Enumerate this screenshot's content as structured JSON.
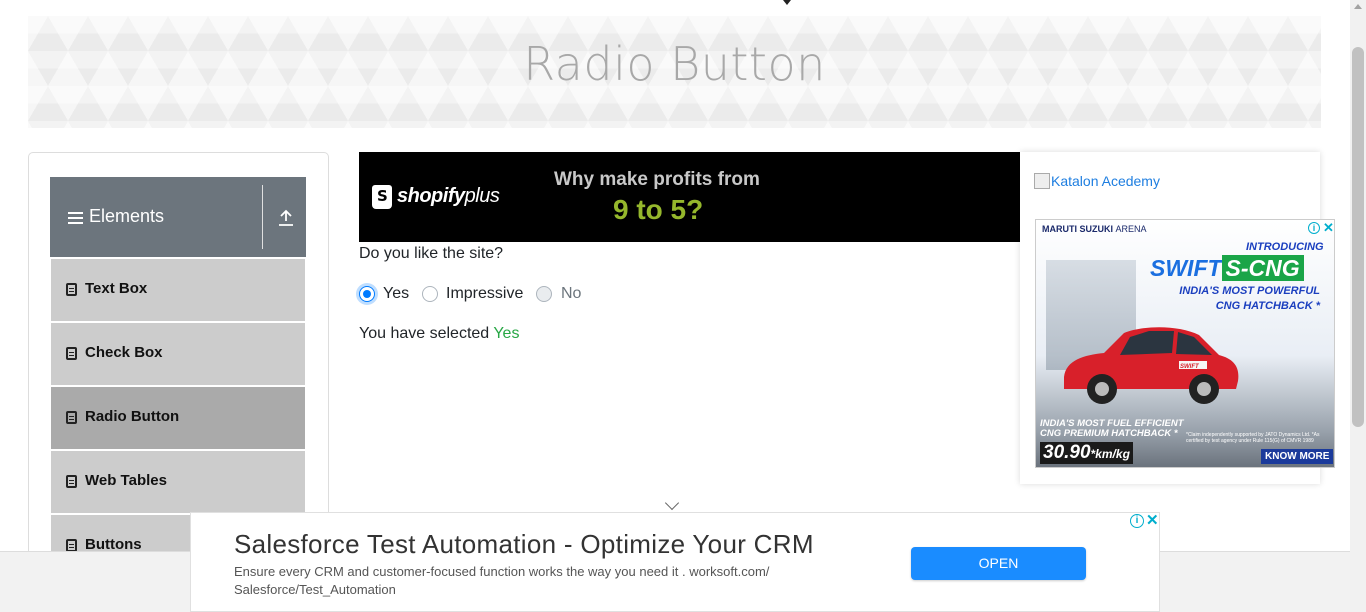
{
  "page": {
    "title": "Radio Button"
  },
  "sidebar": {
    "group_title": "Elements",
    "items": [
      {
        "label": "Text Box",
        "active": false
      },
      {
        "label": "Check Box",
        "active": false
      },
      {
        "label": "Radio Button",
        "active": true
      },
      {
        "label": "Web Tables",
        "active": false
      },
      {
        "label": "Buttons",
        "active": false
      }
    ]
  },
  "top_ad": {
    "brand": "shopify",
    "brand_suffix": "plus",
    "line1": "Why make profits from",
    "line2": "9 to 5?"
  },
  "form": {
    "question": "Do you like the site?",
    "options": [
      {
        "label": "Yes",
        "state": "checked"
      },
      {
        "label": "Impressive",
        "state": "unchecked"
      },
      {
        "label": "No",
        "state": "disabled"
      }
    ],
    "result_prefix": "You have selected",
    "result_value": "Yes"
  },
  "right_ad": {
    "katalon_alt": "Katalon Acedemy",
    "maker": "MARUTI SUZUKI",
    "maker_suffix": "ARENA",
    "introducing": "INTRODUCING",
    "model": "SWIFT",
    "variant": "S-CNG",
    "tagline1": "INDIA'S MOST POWERFUL",
    "tagline2": "CNG HATCHBACK *",
    "efficient1": "INDIA'S MOST FUEL EFFICIENT",
    "efficient2": "CNG PREMIUM HATCHBACK *",
    "mileage": "30.90",
    "mileage_unit": "*km/kg",
    "claim": "*Claim independently supported by JATO Dynamics Ltd. *As certified by test agency under Rule 115(G) of CMVR 1989",
    "cta": "KNOW MORE",
    "car_badge": "SWIFT"
  },
  "bottom_ad": {
    "headline": "Salesforce Test Automation - Optimize Your CRM",
    "description": "Ensure every CRM and customer-focused function works the way you need it . worksoft.com/ Salesforce/Test_Automation",
    "cta": "OPEN"
  },
  "colors": {
    "accent": "#007bff",
    "success": "#28a745",
    "sidebar_header": "#6c757d",
    "menu_item": "#cccccc",
    "menu_item_active": "#aaaaaa",
    "open_button": "#1a8cff"
  },
  "icons": {
    "menu": "hamburger-icon",
    "collapse": "upload-icon",
    "item": "document-icon",
    "chevron": "chevron-down-icon",
    "adchoices": "info-icon",
    "close": "close-icon"
  }
}
